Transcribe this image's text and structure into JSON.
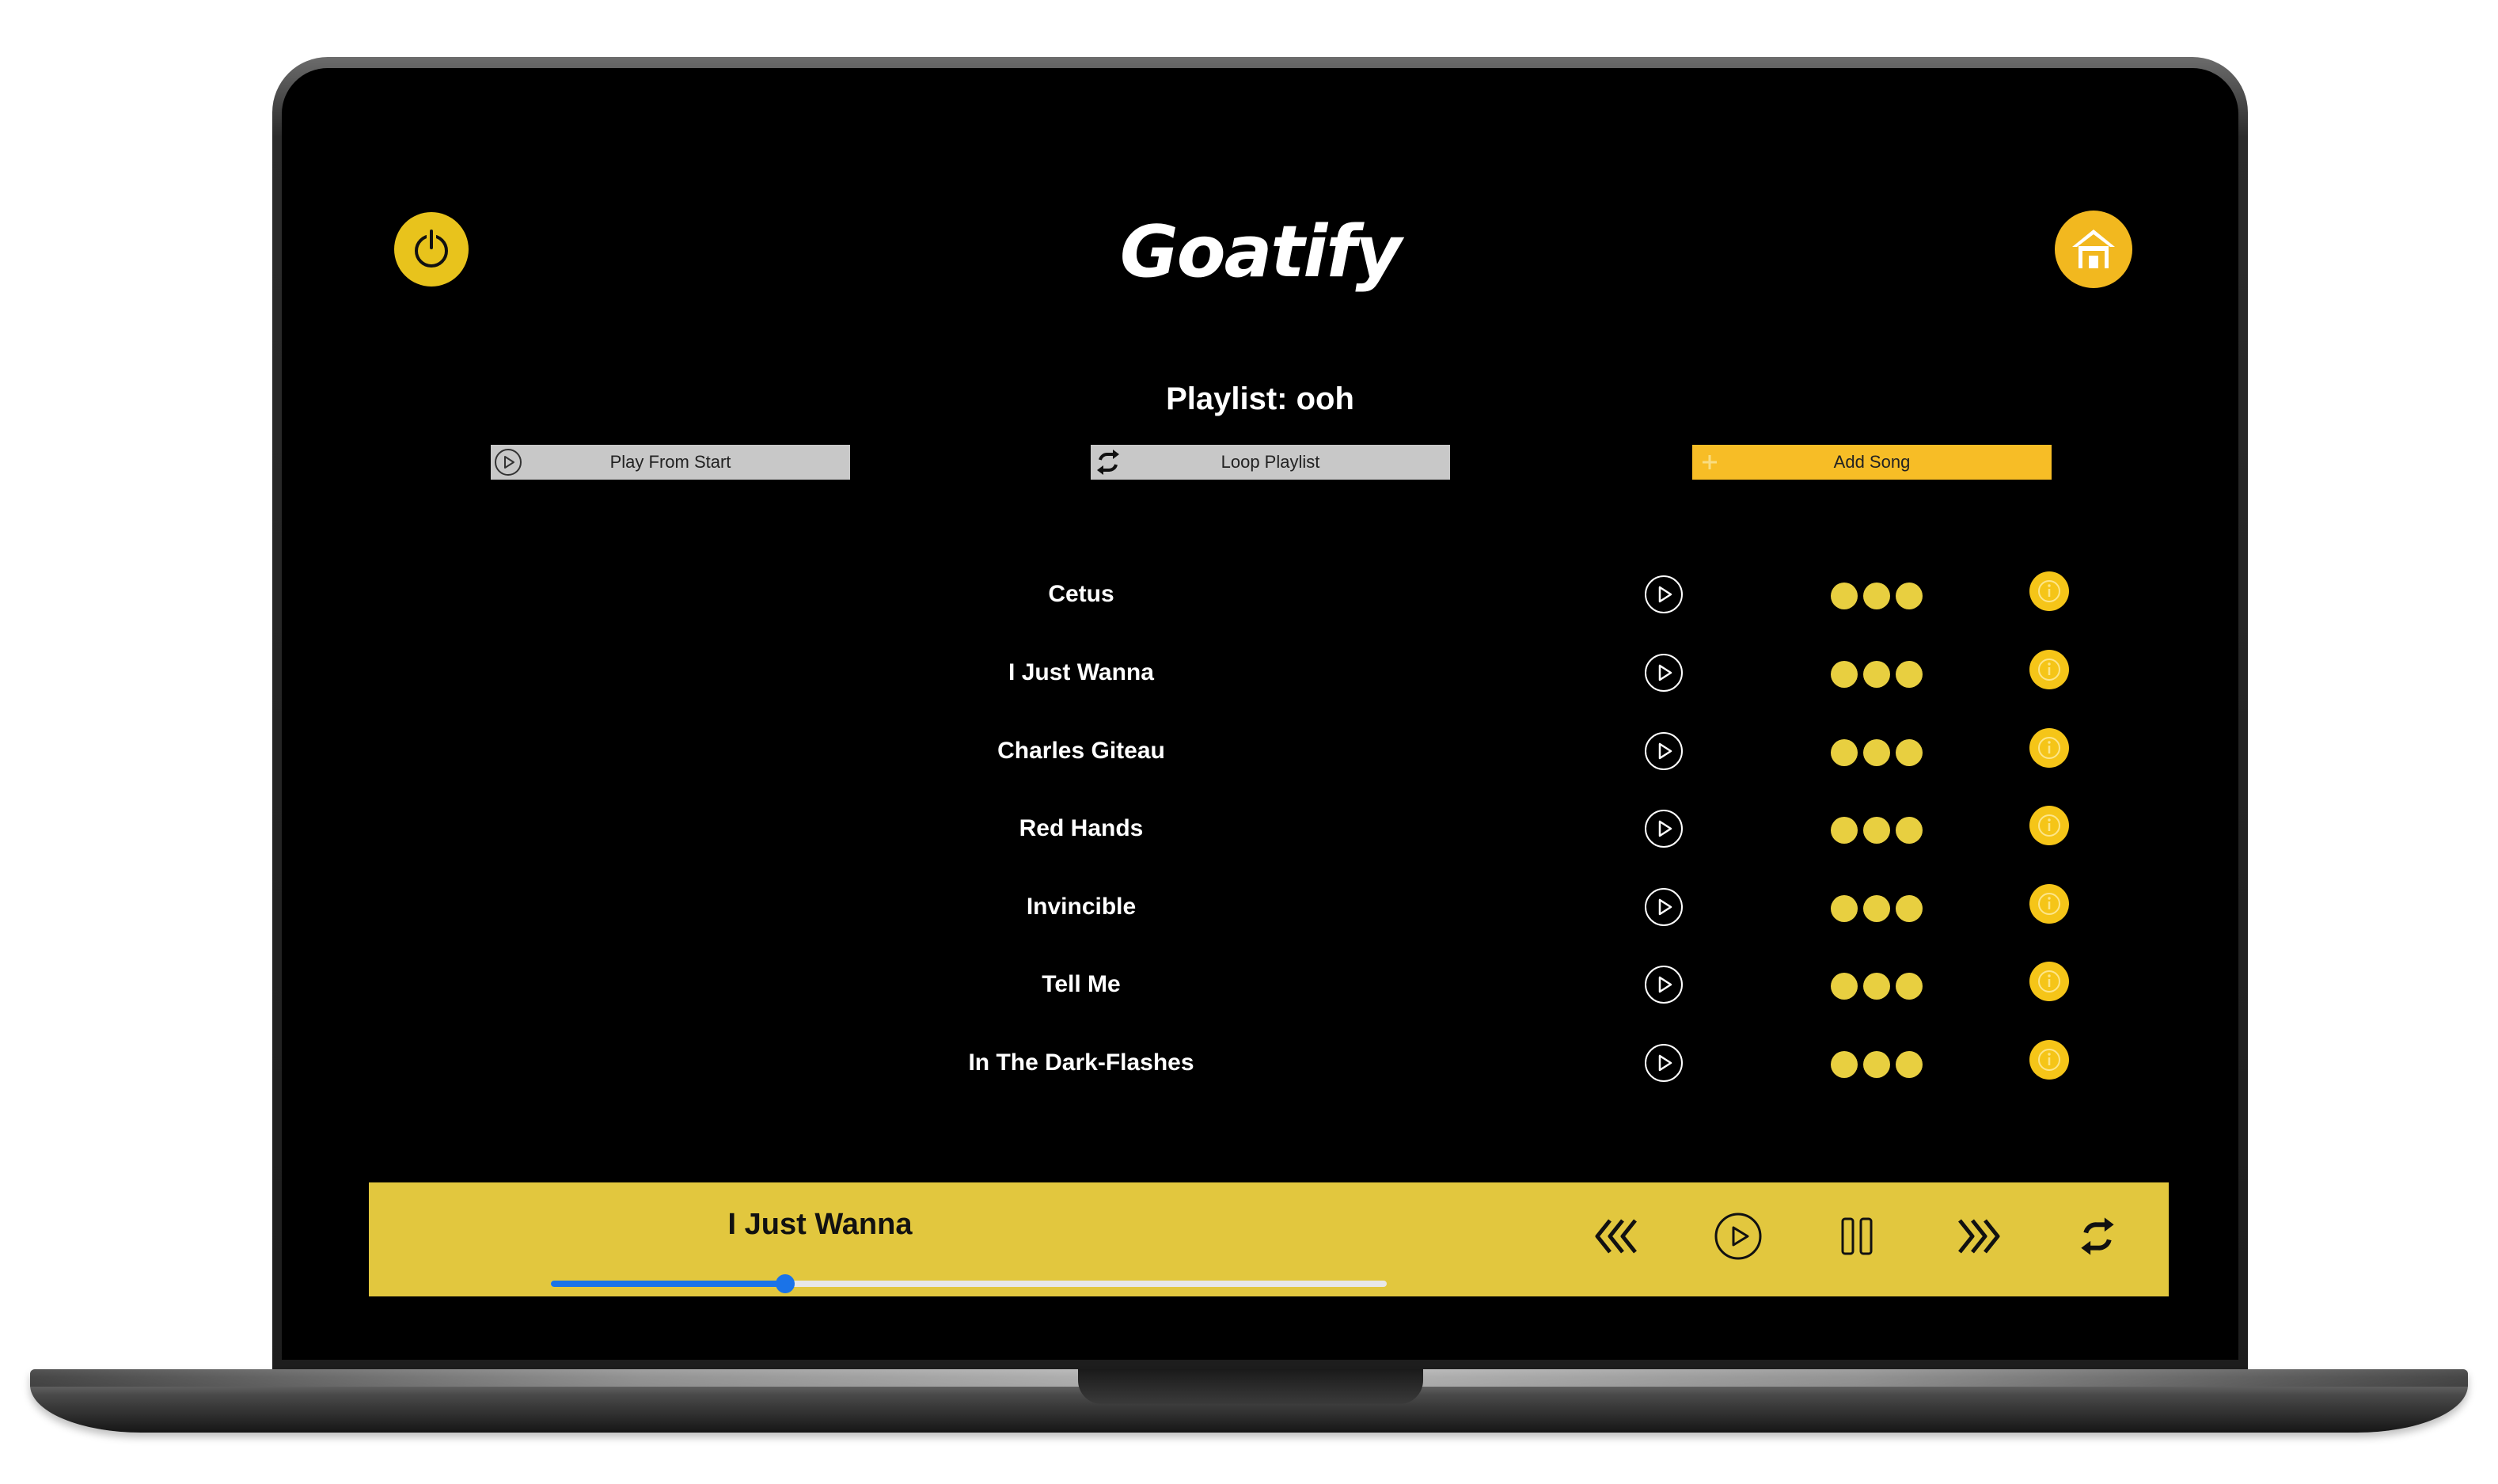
{
  "app": {
    "title": "Goatify",
    "accent_color": "#e8c31c",
    "power_icon": "power-icon",
    "home_icon": "home-icon"
  },
  "playlist": {
    "title": "Playlist: ooh",
    "actions": {
      "play_from_start": "Play From Start",
      "loop_playlist": "Loop Playlist",
      "add_song": "Add Song"
    },
    "songs": [
      {
        "title": "Cetus"
      },
      {
        "title": "I Just Wanna"
      },
      {
        "title": "Charles Giteau"
      },
      {
        "title": "Red Hands"
      },
      {
        "title": "Invincible"
      },
      {
        "title": "Tell Me"
      },
      {
        "title": "In The Dark-Flashes"
      }
    ],
    "row_icons": [
      "play-circle-icon",
      "more-dots-icon",
      "info-icon"
    ]
  },
  "player": {
    "now_playing": "I Just Wanna",
    "progress": 0.28,
    "controls": [
      "rewind-icon",
      "play-icon",
      "pause-icon",
      "fast-forward-icon",
      "repeat-icon"
    ],
    "bar_color": "#e2c73e",
    "progress_color": "#1a73e8"
  }
}
